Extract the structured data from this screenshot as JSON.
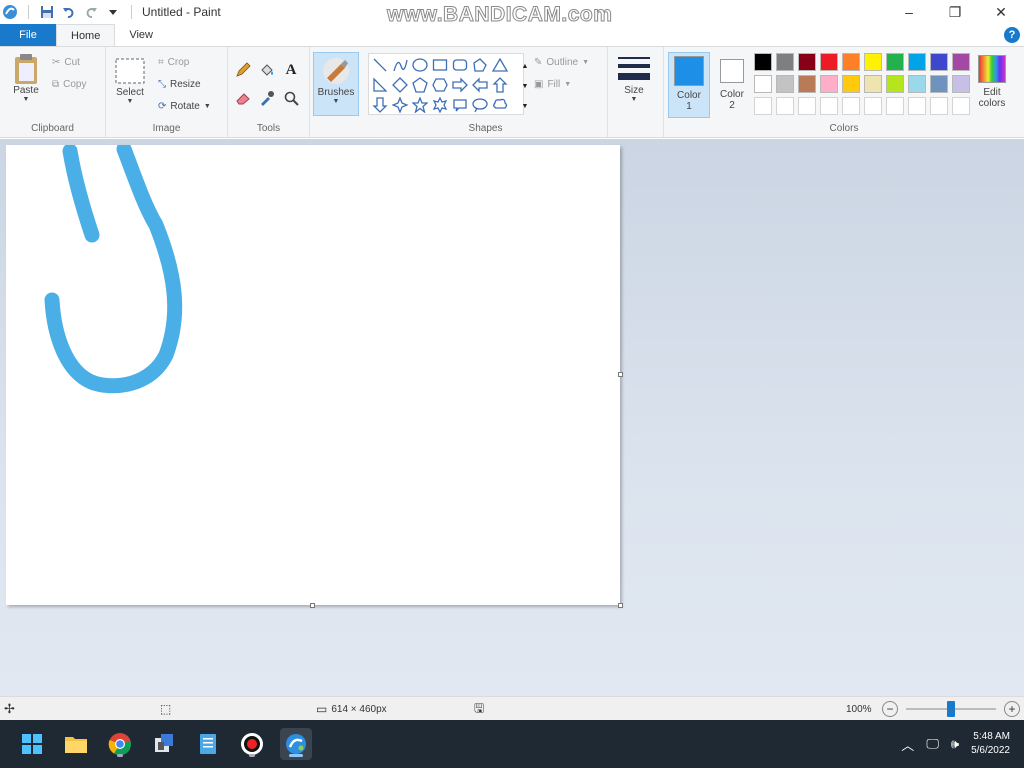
{
  "window": {
    "title": "Untitled - Paint",
    "watermark": "www.BANDICAM.com",
    "controls": {
      "minimize": "–",
      "maximize": "❐",
      "close": "✕"
    }
  },
  "tabs": [
    {
      "label": "File"
    },
    {
      "label": "Home"
    },
    {
      "label": "View"
    }
  ],
  "help_label": "?",
  "ribbon": {
    "clipboard": {
      "label": "Clipboard",
      "paste": "Paste",
      "cut": "Cut",
      "copy": "Copy"
    },
    "image": {
      "label": "Image",
      "select": "Select",
      "crop": "Crop",
      "resize": "Resize",
      "rotate": "Rotate"
    },
    "tools": {
      "label": "Tools"
    },
    "brushes": {
      "label": "Brushes"
    },
    "shapes": {
      "label": "Shapes",
      "outline": "Outline",
      "fill": "Fill"
    },
    "size": {
      "label": "Size"
    },
    "colors": {
      "label": "Colors",
      "color1": "Color 1",
      "color2": "Color 2",
      "edit": "Edit colors",
      "color1_value": "#1e8fe6",
      "color2_value": "#ffffff",
      "palette_row1": [
        "#000000",
        "#7f7f7f",
        "#880015",
        "#ed1c24",
        "#ff7f27",
        "#fff200",
        "#22b14c",
        "#00a2e8",
        "#3f48cc",
        "#a349a4"
      ],
      "palette_row2": [
        "#ffffff",
        "#c3c3c3",
        "#b97a57",
        "#ffaec9",
        "#ffc90e",
        "#efe4b0",
        "#b5e61d",
        "#99d9ea",
        "#7092be",
        "#c8bfe7"
      ]
    }
  },
  "stroke_color": "#3aa8e4",
  "status": {
    "canvas_size": "614 × 460px",
    "zoom": "100%",
    "zoom_level": 0.5
  },
  "taskbar": {
    "time": "5:48 AM",
    "date": "5/6/2022"
  }
}
